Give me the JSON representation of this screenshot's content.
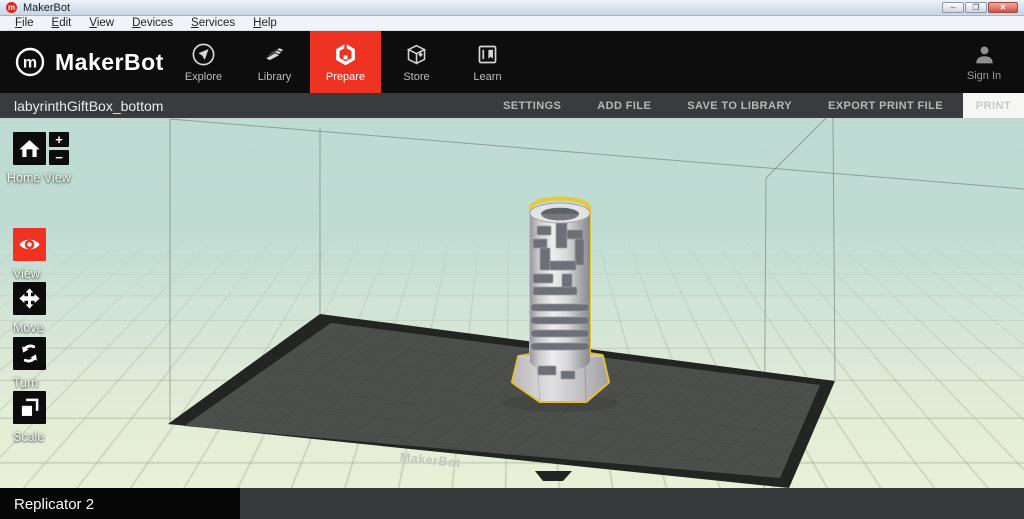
{
  "window": {
    "title": "MakerBot",
    "controls": {
      "minimize": "–",
      "maximize": "❐",
      "close": "✕"
    }
  },
  "menubar": {
    "items": [
      "File",
      "Edit",
      "View",
      "Devices",
      "Services",
      "Help"
    ]
  },
  "navbar": {
    "brand": "MakerBot",
    "items": [
      {
        "label": "Explore"
      },
      {
        "label": "Library"
      },
      {
        "label": "Prepare",
        "active": true
      },
      {
        "label": "Store"
      },
      {
        "label": "Learn"
      }
    ],
    "sign_in": "Sign In"
  },
  "filebar": {
    "filename": "labyrinthGiftBox_bottom",
    "actions": [
      "SETTINGS",
      "ADD FILE",
      "SAVE TO LIBRARY",
      "EXPORT PRINT FILE"
    ],
    "print": "PRINT",
    "print_enabled": false
  },
  "tools": {
    "home": {
      "label": "Home View",
      "zoom_in": "+",
      "zoom_out": "−"
    },
    "items": [
      {
        "label": "View",
        "active": true
      },
      {
        "label": "Move"
      },
      {
        "label": "Turn"
      },
      {
        "label": "Scale"
      }
    ]
  },
  "viewport": {
    "plate_brand": "MakerBot",
    "model": "labyrinth gift box cylinder, selected (yellow outline)"
  },
  "statusbar": {
    "device": "Replicator 2"
  },
  "colors": {
    "accent_red": "#ef3322",
    "nav_black": "#0d0d0d",
    "toolbar_gray": "#3a3b3d",
    "sky_top": "#bedbd2",
    "floor_bottom": "#eaf0d6",
    "plate_surface": "#4c4e4b",
    "plate_border": "#232522",
    "selection_outline": "#ecc531"
  }
}
